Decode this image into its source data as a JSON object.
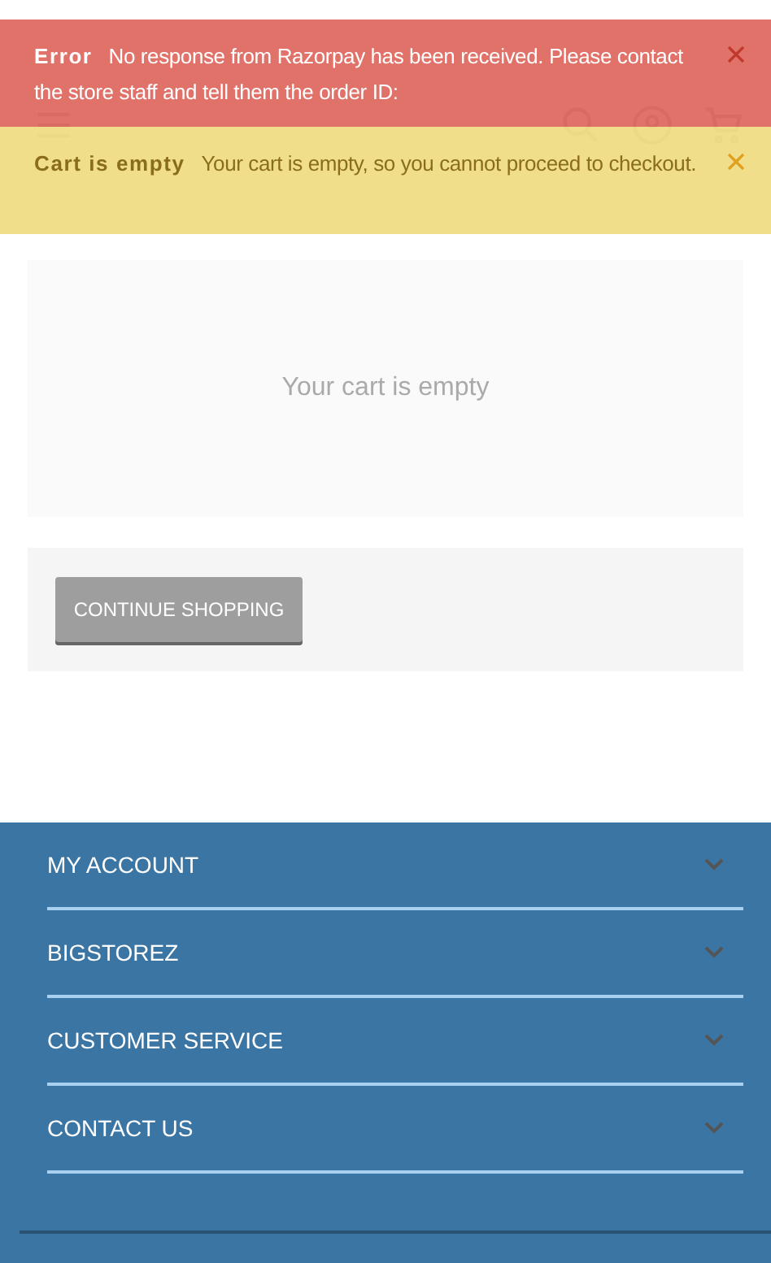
{
  "notices": [
    {
      "kind": "error",
      "title": "Error",
      "message": "No response from Razorpay has been received. Please contact the store staff and tell them the order ID:"
    },
    {
      "kind": "warning",
      "title": "Cart is empty",
      "message": "Your cart is empty, so you cannot proceed to checkout."
    }
  ],
  "cart": {
    "empty_message": "Your cart is empty",
    "button": "CONTINUE SHOPPING"
  },
  "footer": {
    "sections": [
      {
        "label": "MY ACCOUNT",
        "expanded": false
      },
      {
        "label": "BIGSTOREZ",
        "expanded": false
      },
      {
        "label": "CUSTOMER SERVICE",
        "expanded": false
      },
      {
        "label": "CONTACT US",
        "expanded": false
      }
    ]
  }
}
